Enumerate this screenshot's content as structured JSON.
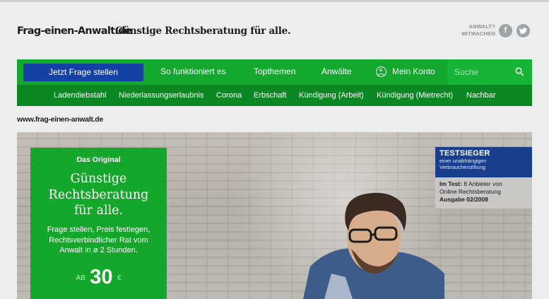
{
  "header": {
    "logo": "Frag-einen-Anwalt.de",
    "tagline": "Günstige Rechtsberatung für alle.",
    "join_line1": "ANWALT?",
    "join_line2": "MITMACHEN",
    "facebook_glyph": "f",
    "twitter_glyph": "t"
  },
  "nav": {
    "cta": "Jetzt Frage stellen",
    "items": [
      "So funktioniert es",
      "Topthemen",
      "Anwälte"
    ],
    "account": "Mein Konto",
    "search_placeholder": "Suche"
  },
  "subnav": [
    "Ladendiebstahl",
    "Niederlassungserlaubnis",
    "Corona",
    "Erbschaft",
    "Kündigung (Arbeit)",
    "Kündigung (Mietrecht)",
    "Nachbar"
  ],
  "url_label": "www.frag-einen-anwalt.de",
  "hero": {
    "badge": "Das Original",
    "title_lines": [
      "Günstige",
      "Rechtsberatung",
      "für alle."
    ],
    "desc_lines": [
      "Frage stellen, Preis festlegen,",
      "Rechtsverbindlicher Rat vom",
      "Anwalt in ø 2 Stunden."
    ],
    "price_prefix": "AB",
    "price": "30",
    "currency": "€"
  },
  "test_box": {
    "title": "TESTSIEGER",
    "sub1": "einer unabhängigen",
    "sub2": "Verbraucherstiftung",
    "line1_bold": "Im Test:",
    "line1_rest": " 8 Anbieter von",
    "line2": "Online Rechtsberatung",
    "line3": "Ausgabe 02/2008"
  },
  "colors": {
    "nav_green": "#12a92e",
    "subnav_green": "#0b8723",
    "cta_blue": "#1540a6",
    "test_blue": "#1a3f8c"
  }
}
